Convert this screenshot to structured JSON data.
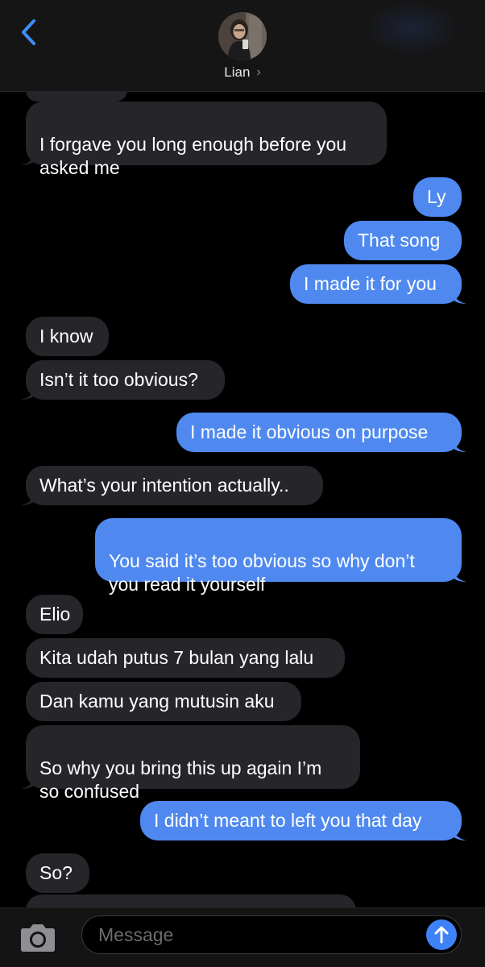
{
  "header": {
    "contact_name": "Lian",
    "chevron": "›"
  },
  "messages": [
    {
      "side": "received",
      "text": "I forgave you long enough before you\nasked me"
    },
    {
      "side": "sent",
      "text": "Ly"
    },
    {
      "side": "sent",
      "text": "That song"
    },
    {
      "side": "sent",
      "text": "I made it for you"
    },
    {
      "side": "received",
      "text": "I know"
    },
    {
      "side": "received",
      "text": "Isn’t it too obvious?"
    },
    {
      "side": "sent",
      "text": "I made it obvious on purpose"
    },
    {
      "side": "received",
      "text": "What’s your intention actually.."
    },
    {
      "side": "sent",
      "text": "You said it’s too obvious so why don’t\nyou read it yourself"
    },
    {
      "side": "received",
      "text": "Elio"
    },
    {
      "side": "received",
      "text": "Kita udah putus 7 bulan yang lalu"
    },
    {
      "side": "received",
      "text": "Dan kamu yang mutusin aku"
    },
    {
      "side": "received",
      "text": "So why you bring this up again I’m\nso confused"
    },
    {
      "side": "sent",
      "text": "I didn’t meant to left you that day"
    },
    {
      "side": "received",
      "text": "So?"
    }
  ],
  "composer": {
    "placeholder": "Message"
  },
  "icons": {
    "back": "chevron-left-icon",
    "camera": "camera-icon",
    "send": "arrow-up-icon"
  },
  "colors": {
    "sent_bubble": "#4f89f0",
    "received_bubble": "#26252a",
    "accent": "#3d82f6",
    "background": "#000000"
  }
}
